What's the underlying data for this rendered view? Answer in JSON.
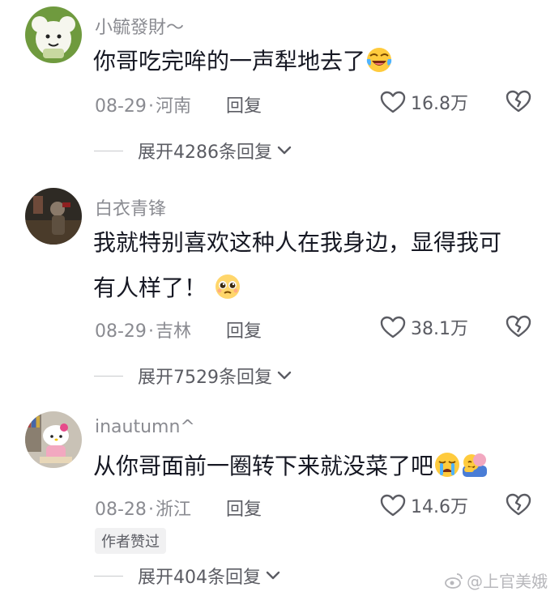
{
  "comments": [
    {
      "username": "小毓發財〜",
      "text": "你哥吃完哞的一声犁地去了",
      "date": "08-29",
      "location": "河南",
      "reply_label": "回复",
      "likes": "16.8万",
      "expand_label": "展开4286条回复",
      "avatar_icon": "green-cartoon-avatar",
      "emojis": [
        "laughing-crying-emoji"
      ]
    },
    {
      "username": "白衣青锋",
      "text_line1": "我就特别喜欢这种人在我身边，显得我可",
      "text_line2": "有人样了！",
      "date": "08-29",
      "location": "吉林",
      "reply_label": "回复",
      "likes": "38.1万",
      "expand_label": "展开7529条回复",
      "avatar_icon": "dark-photo-avatar",
      "emojis": [
        "pleading-emoji"
      ]
    },
    {
      "username": "inautumn^",
      "text": "从你哥面前一圈转下来就没菜了吧",
      "date": "08-28",
      "location": "浙江",
      "reply_label": "回复",
      "likes": "14.6万",
      "author_badge": "作者赞过",
      "expand_label": "展开404条回复",
      "avatar_icon": "hello-kitty-avatar",
      "emojis": [
        "crying-emoji",
        "hugging-emoji"
      ]
    }
  ],
  "watermark": "@上官美娥",
  "colors": {
    "text_primary": "#161823",
    "text_secondary": "#8a8b91",
    "text_action": "#5b5c63",
    "divider": "#c9cacd"
  }
}
